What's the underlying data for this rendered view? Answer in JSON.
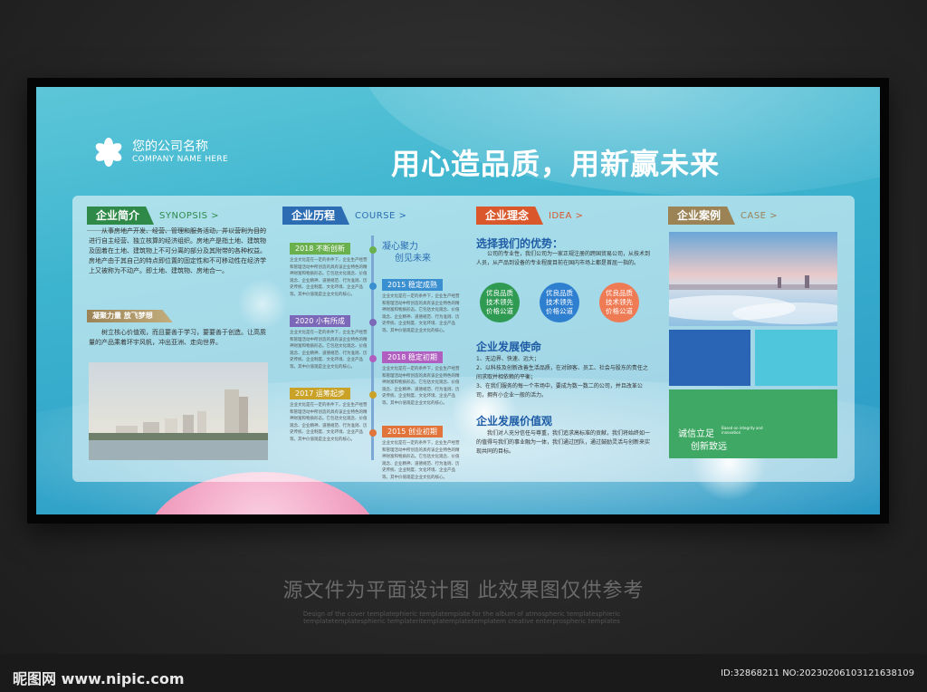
{
  "logo": {
    "name": "您的公司名称",
    "en": "COMPANY NAME HERE",
    "icon": "flower-icon"
  },
  "slogan": "用心造品质，用新赢未来",
  "synopsis": {
    "tag": "企业简介",
    "en": "SYNOPSIS >",
    "color": "#2f8a4a",
    "body": "从事房地产开发、经营、管理和服务活动，并以营利为目的进行自主经营、独立核算的经济组织。房地产是指土地、建筑物及固着在土地、建筑物上不可分离的部分及其附带的各种权益。房地产由于其自己的特点即位置的固定性和不可移动性在经济学上又被称为不动产。即土地、建筑物、房地合一。",
    "sub_tag": "凝聚力量 放飞梦想",
    "sub_body": "树立核心价值观，而且要善于学习，要要善于创造。让高质量的产品乘着环宇风帆，冲出亚洲、走向世界。"
  },
  "course": {
    "tag": "企业历程",
    "en": "COURSE >",
    "color": "#2b6cb3",
    "headline": [
      "凝心聚力",
      "创见未来"
    ],
    "events": [
      {
        "label": "2018 不断创新",
        "color": "#6ab04c",
        "text": "企业文化是在一定的条件下，企业生产经营和管理活动中所创造的具有该企业特色的精神财富和物质形态。它包括文化观念、价值观念、企业精神、道德规范、行为准则、历史传统、企业制度、文化环境、企业产品等。其中价值观是企业文化的核心。"
      },
      {
        "label": "2015 稳定成熟",
        "color": "#3a8fd0",
        "text": "企业文化是在一定的条件下，企业生产经营和管理活动中所创造的具有该企业特色的精神财富和物质形态。它包括文化观念、价值观念、企业精神、道德规范、行为准则、历史传统、企业制度、文化环境、企业产品等。其中价值观是企业文化的核心。"
      },
      {
        "label": "2020 小有所成",
        "color": "#7b68b8",
        "text": "企业文化是在一定的条件下，企业生产经营和管理活动中所创造的具有该企业特色的精神财富和物质形态。它包括文化观念、价值观念、企业精神、道德规范、行为准则、历史传统、企业制度、文化环境、企业产品等。其中价值观是企业文化的核心。"
      },
      {
        "label": "2018 稳定初期",
        "color": "#b05fc0",
        "text": "企业文化是在一定的条件下，企业生产经营和管理活动中所创造的具有该企业特色的精神财富和物质形态。它包括文化观念、价值观念、企业精神、道德规范、行为准则、历史传统、企业制度、文化环境、企业产品等。其中价值观是企业文化的核心。"
      },
      {
        "label": "2017 运筹起步",
        "color": "#c9a227",
        "text": "企业文化是在一定的条件下，企业生产经营和管理活动中所创造的具有该企业特色的精神财富和物质形态。它包括文化观念、价值观念、企业精神、道德规范、行为准则、历史传统、企业制度、文化环境、企业产品等。其中价值观是企业文化的核心。"
      },
      {
        "label": "2015 创业初期",
        "color": "#e0743a",
        "text": "企业文化是在一定的条件下，企业生产经营和管理活动中所创造的具有该企业特色的精神财富和物质形态。它包括文化观念、价值观念、企业精神、道德规范、行为准则、历史传统、企业制度、文化环境、企业产品等。其中价值观是企业文化的核心。"
      }
    ]
  },
  "idea": {
    "tag": "企业理念",
    "en": "IDEA >",
    "color": "#d9572b",
    "advantage_title": "选择我们的优势：",
    "advantage_body": "公司的专业性，我们公司为一家正规注册的跨国贸易公司，从技术到人员，从产品到设备的专业程度目前在国内市场上都是首屈一指的。",
    "circles": [
      {
        "lines": [
          "优良品质",
          "技术领先",
          "价格公道"
        ],
        "color": "#2f9a52"
      },
      {
        "lines": [
          "优良品质",
          "技术领先",
          "价格公道"
        ],
        "color": "#2f7fd0"
      },
      {
        "lines": [
          "优良品质",
          "技术领先",
          "价格公道"
        ],
        "color": "#ef7b55"
      }
    ],
    "mission_title": "企业发展使命",
    "mission_items": [
      "1、无边界、快速、远大；",
      "2、以科技及创新改善生活品质，在对顾客、员工、社会与股东的责任之间求取并相依赖的平衡；",
      "3、在我们服务的每一个市场中，要成为数一数二的公司，并且改革公司，拥有小企业一般的活力。"
    ],
    "value_title": "企业发展价值观",
    "value_body": "我们对人充分信任与尊重，我们追求高标准的贡献，我们将始终如一的值得与我们的事业融为一体，我们通过团队，通过鼓励灵活与创新来实现共同的目标。"
  },
  "case": {
    "tag": "企业案例",
    "en": "CASE >",
    "color": "#9b8356",
    "green_title_1": "诚信立足",
    "green_title_2": "创新致远",
    "green_en": "Based on integrity and innovation",
    "tile_colors": [
      "#2a64b5",
      "#4fc6dc",
      "#3fa864"
    ]
  },
  "watermark": {
    "main": "源文件为平面设计图 此效果图仅供参考",
    "small": "Design of the cover templatephieric templatempiate for the album of atmospheric templatesphieric templatetemplatesphieric templateritemplatemplatetemplatem creative enterprospheric templates"
  },
  "footer": {
    "site": "昵图网 www.nipic.com",
    "id": "ID:32868211 NO:20230206103121638109"
  }
}
